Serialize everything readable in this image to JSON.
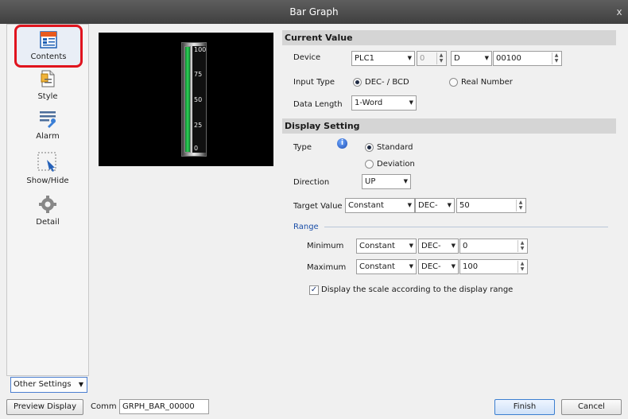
{
  "window": {
    "title": "Bar Graph",
    "close_label": "x"
  },
  "sidebar": {
    "items": [
      {
        "label": "Contents",
        "icon": "contents-icon"
      },
      {
        "label": "Style",
        "icon": "style-icon"
      },
      {
        "label": "Alarm",
        "icon": "alarm-icon"
      },
      {
        "label": "Show/Hide",
        "icon": "show-hide-icon"
      },
      {
        "label": "Detail",
        "icon": "detail-icon"
      }
    ],
    "other_settings": "Other Settings"
  },
  "preview": {
    "scale_labels": [
      "100",
      "75",
      "50",
      "25",
      "0"
    ],
    "fill_percent": 100
  },
  "current_value": {
    "header": "Current Value",
    "device_label": "Device",
    "device_plc": "PLC1",
    "device_num": "0",
    "device_type": "D",
    "device_addr": "00100",
    "input_type_label": "Input Type",
    "input_opt1": "DEC- / BCD",
    "input_opt2": "Real Number",
    "data_length_label": "Data Length",
    "data_length": "1-Word"
  },
  "display_setting": {
    "header": "Display Setting",
    "type_label": "Type",
    "type_opt1": "Standard",
    "type_opt2": "Deviation",
    "direction_label": "Direction",
    "direction": "UP",
    "target_label": "Target Value",
    "target_mode": "Constant",
    "target_fmt": "DEC-",
    "target_value": "50",
    "range_label": "Range",
    "min_label": "Minimum",
    "min_mode": "Constant",
    "min_fmt": "DEC-",
    "min_value": "0",
    "max_label": "Maximum",
    "max_mode": "Constant",
    "max_fmt": "DEC-",
    "max_value": "100",
    "scale_check": "Display the scale according to the display range"
  },
  "footer": {
    "preview_display": "Preview Display",
    "comm_label": "Comm",
    "comm_value": "GRPH_BAR_00000",
    "finish": "Finish",
    "cancel": "Cancel"
  },
  "colors": {
    "accent_red": "#e0141e",
    "gauge_green": "#2fd65a",
    "info_blue": "#1d4db3"
  }
}
